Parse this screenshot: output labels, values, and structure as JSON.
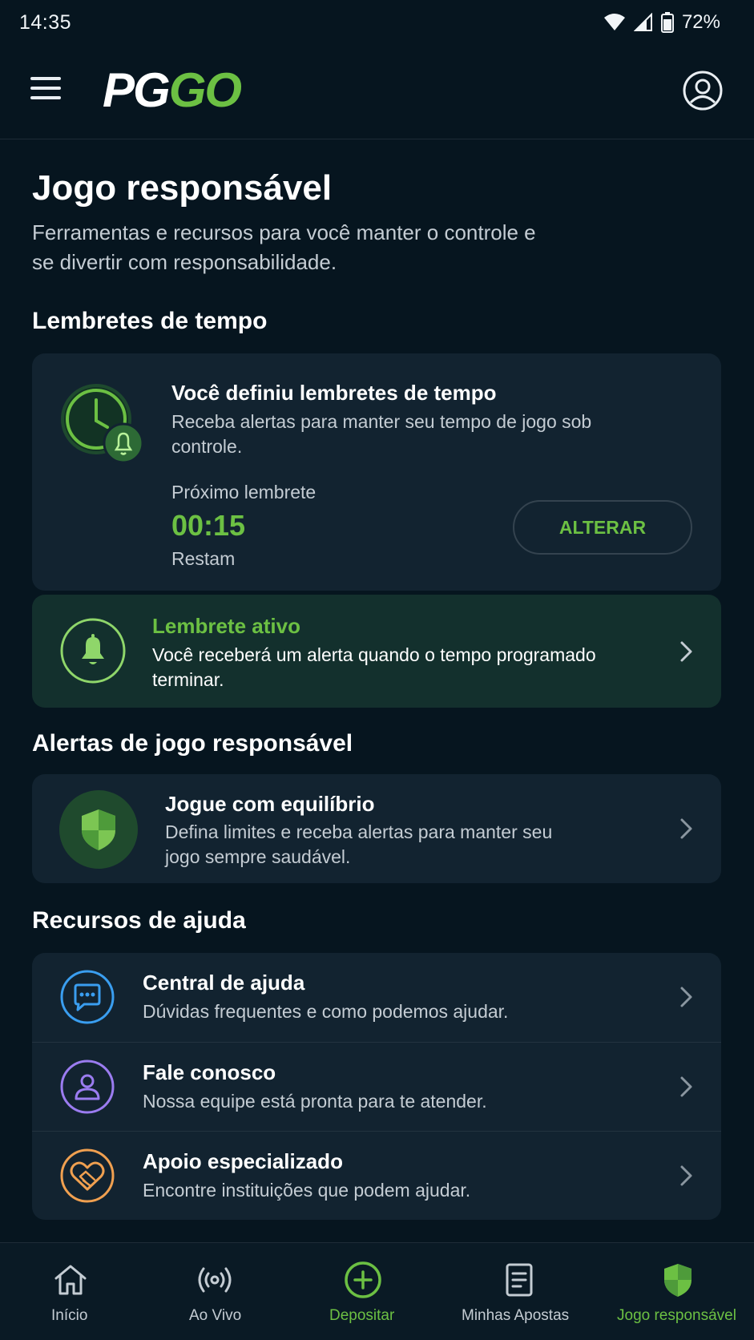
{
  "status_bar": {
    "time": "14:35",
    "battery": "72%"
  },
  "header": {
    "logo_part1": "PG",
    "logo_part2": "GO"
  },
  "page": {
    "title": "Jogo responsável",
    "subtitle": "Ferramentas e recursos para você manter o controle e se divertir com responsabilidade."
  },
  "time_reminders": {
    "heading": "Lembretes de tempo",
    "card": {
      "title": "Você definiu lembretes de tempo",
      "description": "Receba alertas para manter seu tempo de jogo sob controle.",
      "next_label": "Próximo lembrete",
      "timer": "00:15",
      "remaining_label": "Restam",
      "change_button": "ALTERAR"
    },
    "active": {
      "title": "Lembrete ativo",
      "description": "Você receberá um alerta quando o tempo programado terminar."
    }
  },
  "responsible_alerts": {
    "heading": "Alertas de jogo responsável",
    "card": {
      "title": "Jogue com equilíbrio",
      "description": "Defina limites e receba alertas para manter seu jogo sempre saudável."
    }
  },
  "help_resources": {
    "heading": "Recursos de ajuda",
    "items": [
      {
        "title": "Central de ajuda",
        "description": "Dúvidas frequentes e como podemos ajudar.",
        "icon": "chat-icon",
        "color": "#3a9ef0"
      },
      {
        "title": "Fale conosco",
        "description": "Nossa equipe está pronta para te atender.",
        "icon": "person-icon",
        "color": "#9b7cf0"
      },
      {
        "title": "Apoio especializado",
        "description": "Encontre instituições que podem ajudar.",
        "icon": "handshake-heart-icon",
        "color": "#f0a050"
      }
    ]
  },
  "bottom_nav": {
    "items": [
      {
        "label": "Início",
        "icon": "home-icon"
      },
      {
        "label": "Ao Vivo",
        "icon": "live-broadcast-icon"
      },
      {
        "label": "Depositar",
        "icon": "plus-circle-icon"
      },
      {
        "label": "Minhas Apostas",
        "icon": "document-icon"
      },
      {
        "label": "Jogo responsável",
        "icon": "shield-icon"
      }
    ],
    "active": "Jogo responsável"
  },
  "colors": {
    "accent": "#6cc043",
    "background": "#06151f",
    "card": "#122330",
    "active_card": "#13302d"
  }
}
